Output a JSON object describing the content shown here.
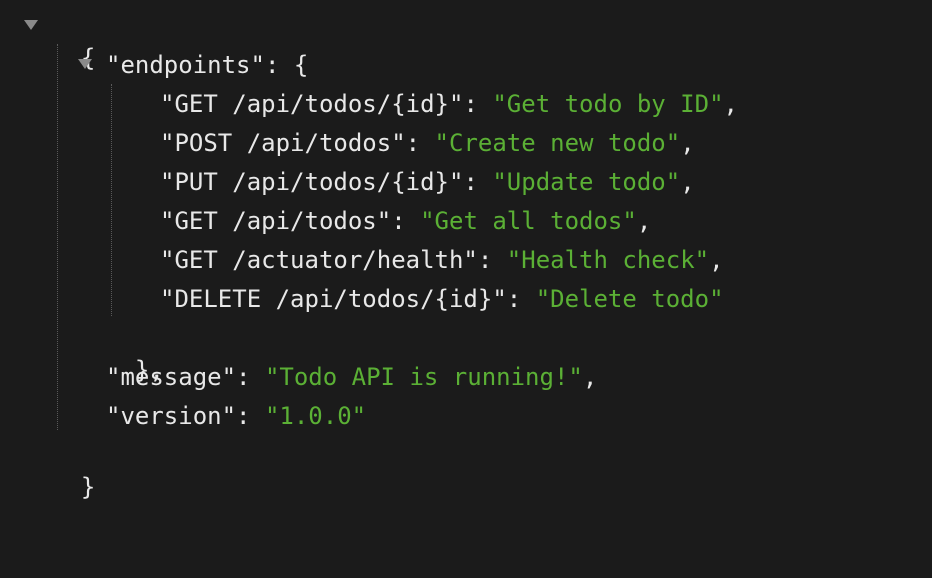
{
  "json_viewer": {
    "open_brace": "{",
    "close_brace": "}",
    "endpoints": {
      "key": "\"endpoints\"",
      "separator": ": ",
      "open": "{",
      "close": "},",
      "items": [
        {
          "key": "\"GET /api/todos/{id}\"",
          "value": "\"Get todo by ID\"",
          "comma": ","
        },
        {
          "key": "\"POST /api/todos\"",
          "value": "\"Create new todo\"",
          "comma": ","
        },
        {
          "key": "\"PUT /api/todos/{id}\"",
          "value": "\"Update todo\"",
          "comma": ","
        },
        {
          "key": "\"GET /api/todos\"",
          "value": "\"Get all todos\"",
          "comma": ","
        },
        {
          "key": "\"GET /actuator/health\"",
          "value": "\"Health check\"",
          "comma": ","
        },
        {
          "key": "\"DELETE /api/todos/{id}\"",
          "value": "\"Delete todo\"",
          "comma": ""
        }
      ]
    },
    "message": {
      "key": "\"message\"",
      "value": "\"Todo API is running!\"",
      "comma": ","
    },
    "version": {
      "key": "\"version\"",
      "value": "\"1.0.0\"",
      "comma": ""
    },
    "colors": {
      "background": "#1b1b1b",
      "text": "#e8e8e8",
      "string": "#5bb035",
      "toggle": "#8a8a8a",
      "guide": "#5a5a5a"
    }
  }
}
